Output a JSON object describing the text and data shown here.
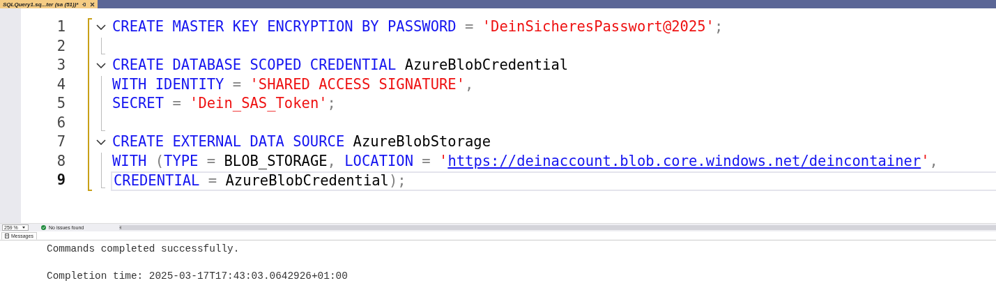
{
  "document_tab": {
    "title": "SQLQuery1.sq...ter (sa (51))*",
    "selected": true,
    "modified": true
  },
  "editor": {
    "lines": [
      {
        "number": "1",
        "collapsible": true,
        "current": false,
        "tokens": [
          {
            "kind": "keyword",
            "text": "CREATE MASTER KEY ENCRYPTION BY PASSWORD "
          },
          {
            "kind": "operator",
            "text": "= "
          },
          {
            "kind": "string",
            "text": "'DeinSicheresPasswort@2025'"
          },
          {
            "kind": "operator",
            "text": ";"
          }
        ]
      },
      {
        "number": "2",
        "collapsible": false,
        "current": false
      },
      {
        "number": "3",
        "collapsible": true,
        "current": false,
        "tokens": [
          {
            "kind": "keyword",
            "text": "CREATE DATABASE SCOPED CREDENTIAL "
          },
          {
            "kind": "plain",
            "text": "AzureBlobCredential"
          }
        ]
      },
      {
        "number": "4",
        "collapsible": false,
        "current": false,
        "tokens": [
          {
            "kind": "keyword",
            "text": "WITH IDENTITY "
          },
          {
            "kind": "operator",
            "text": "= "
          },
          {
            "kind": "string",
            "text": "'SHARED ACCESS SIGNATURE'"
          },
          {
            "kind": "operator",
            "text": ","
          }
        ]
      },
      {
        "number": "5",
        "collapsible": false,
        "current": false,
        "tokens": [
          {
            "kind": "keyword",
            "text": "SECRET "
          },
          {
            "kind": "operator",
            "text": "= "
          },
          {
            "kind": "string",
            "text": "'Dein_SAS_Token'"
          },
          {
            "kind": "operator",
            "text": ";"
          }
        ]
      },
      {
        "number": "6",
        "collapsible": false,
        "current": false
      },
      {
        "number": "7",
        "collapsible": true,
        "current": false,
        "tokens": [
          {
            "kind": "keyword",
            "text": "CREATE EXTERNAL DATA SOURCE "
          },
          {
            "kind": "plain",
            "text": "AzureBlobStorage"
          }
        ]
      },
      {
        "number": "8",
        "collapsible": false,
        "current": false,
        "tokens": [
          {
            "kind": "keyword",
            "text": "WITH "
          },
          {
            "kind": "operator",
            "text": "("
          },
          {
            "kind": "keyword",
            "text": "TYPE "
          },
          {
            "kind": "operator",
            "text": "= "
          },
          {
            "kind": "plain",
            "text": "BLOB_STORAGE"
          },
          {
            "kind": "operator",
            "text": ", "
          },
          {
            "kind": "keyword",
            "text": "LOCATION "
          },
          {
            "kind": "operator",
            "text": "= "
          },
          {
            "kind": "string",
            "text": "'"
          },
          {
            "kind": "link",
            "text": "https://deinaccount.blob.core.windows.net/deincontainer"
          },
          {
            "kind": "string",
            "text": "'"
          },
          {
            "kind": "operator",
            "text": ","
          }
        ]
      },
      {
        "number": "9",
        "collapsible": false,
        "current": true,
        "tokens": [
          {
            "kind": "keyword",
            "text": "CREDENTIAL "
          },
          {
            "kind": "operator",
            "text": "= "
          },
          {
            "kind": "plain",
            "text": "AzureBlobCredential"
          },
          {
            "kind": "operator",
            "text": ");"
          }
        ]
      }
    ]
  },
  "status_bar": {
    "zoom": "259 %",
    "issues": "No issues found",
    "issues_ok": true
  },
  "results_tab": {
    "label": "Messages",
    "selected": true
  },
  "messages": [
    "Commands completed successfully.",
    "Completion time: 2025-03-17T17:43:03.0642926+01:00"
  ]
}
